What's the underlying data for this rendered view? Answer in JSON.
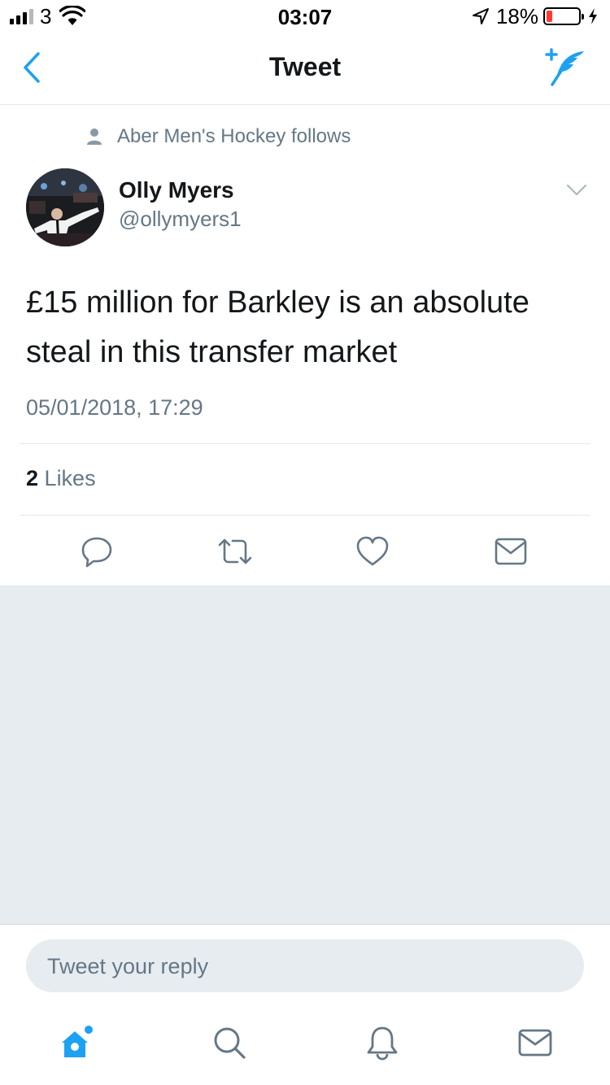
{
  "status_bar": {
    "carrier": "3",
    "time": "03:07",
    "battery_percent_label": "18%",
    "battery_level": 0.18,
    "signal_bars_filled": 3,
    "signal_bars_total": 4
  },
  "nav": {
    "title": "Tweet",
    "back_icon": "chevron-left-icon",
    "compose_icon": "compose-tweet-icon"
  },
  "tweet": {
    "social_context": "Aber Men's Hockey follows",
    "author_name": "Olly Myers",
    "author_handle": "@ollymyers1",
    "text": "£15 million for Barkley is an absolute steal in this transfer market",
    "timestamp": "05/01/2018, 17:29",
    "likes_count": "2",
    "likes_label": "Likes"
  },
  "actions": [
    "reply-icon",
    "retweet-icon",
    "like-icon",
    "direct-message-icon"
  ],
  "reply": {
    "placeholder": "Tweet your reply"
  },
  "tabbar": {
    "items": [
      "home-icon",
      "search-icon",
      "notifications-icon",
      "messages-icon"
    ],
    "active": "home-icon"
  },
  "colors": {
    "accent": "#1da1f2",
    "secondary_text": "#657786",
    "primary_text": "#14171a",
    "divider": "#e1e8ed",
    "background_gray": "#e6ecf0",
    "battery_low": "#ff3b30"
  }
}
